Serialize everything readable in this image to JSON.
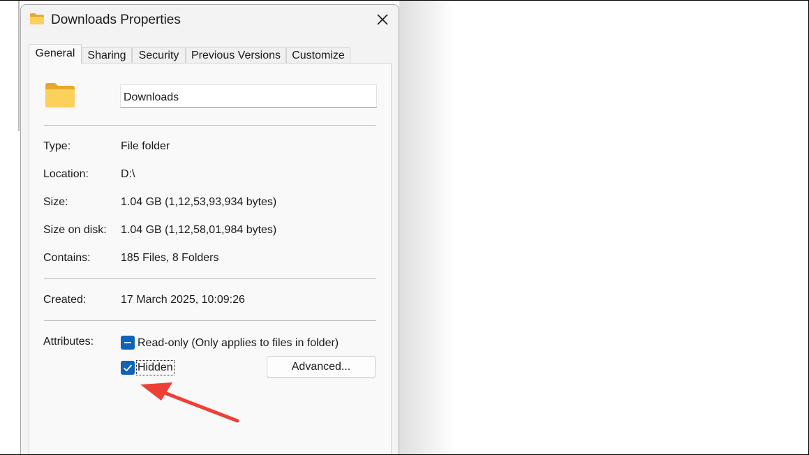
{
  "window": {
    "title": "Downloads Properties",
    "title_icon": "folder-icon",
    "close_icon": "close-icon"
  },
  "tabs": [
    {
      "label": "General",
      "active": true
    },
    {
      "label": "Sharing",
      "active": false
    },
    {
      "label": "Security",
      "active": false
    },
    {
      "label": "Previous Versions",
      "active": false
    },
    {
      "label": "Customize",
      "active": false
    }
  ],
  "general": {
    "folder_icon": "folder-icon",
    "name_value": "Downloads",
    "type_label": "Type:",
    "type_value": "File folder",
    "location_label": "Location:",
    "location_value": "D:\\",
    "size_label": "Size:",
    "size_value": "1.04 GB (1,12,53,93,934 bytes)",
    "size_on_disk_label": "Size on disk:",
    "size_on_disk_value": "1.04 GB (1,12,58,01,984 bytes)",
    "contains_label": "Contains:",
    "contains_value": "185 Files, 8 Folders",
    "created_label": "Created:",
    "created_value": "17 March 2025, 10:09:26",
    "attributes_label": "Attributes:",
    "readonly_label": "Read-only (Only applies to files in folder)",
    "readonly_state": "indeterminate",
    "hidden_label": "Hidden",
    "hidden_state": "checked",
    "advanced_label": "Advanced..."
  },
  "colors": {
    "accent": "#0f63b8",
    "annotation_arrow": "#ee4036"
  }
}
